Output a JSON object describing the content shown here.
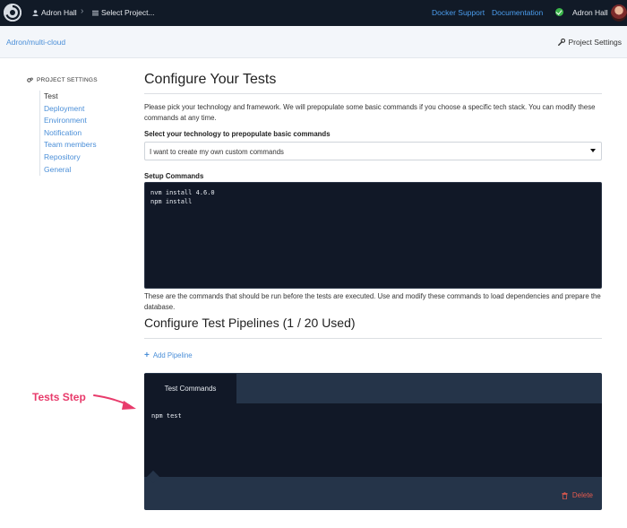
{
  "topnav": {
    "logo": "circleci-logo-icon",
    "user_crumb": "Adron Hall",
    "project_crumb": "Select Project...",
    "docker_support": "Docker Support",
    "documentation": "Documentation",
    "user_name": "Adron Hall",
    "status_color": "#3bb54a"
  },
  "subheader": {
    "project": "Adron/multi-cloud",
    "settings": "Project Settings"
  },
  "sidebar": {
    "heading": "PROJECT SETTINGS",
    "items": [
      {
        "label": "Test",
        "active": true
      },
      {
        "label": "Deployment"
      },
      {
        "label": "Environment"
      },
      {
        "label": "Notification"
      },
      {
        "label": "Team members"
      },
      {
        "label": "Repository"
      },
      {
        "label": "General"
      }
    ]
  },
  "main": {
    "title": "Configure Your Tests",
    "intro": "Please pick your technology and framework. We will prepopulate some basic commands if you choose a specific tech stack. You can modify these commands at any time.",
    "tech_label": "Select your technology to prepopulate basic commands",
    "tech_selected": "I want to create my own custom commands",
    "setup_label": "Setup Commands",
    "setup_commands": [
      "nvm install 4.6.0",
      "npm install"
    ],
    "setup_help": "These are the commands that should be run before the tests are executed. Use and modify these commands to load dependencies and prepare the database.",
    "pipelines_title": "Configure Test Pipelines (1 / 20 Used)",
    "add_pipeline": "Add Pipeline",
    "pipeline": {
      "tab": "Test Commands",
      "commands": [
        "npm test"
      ],
      "delete": "Delete"
    }
  },
  "annotation": {
    "text": "Tests Step",
    "color": "#e83b6b"
  },
  "colors": {
    "topbar": "#111a27",
    "link": "#4b8fd8",
    "editor": "#111827",
    "pipeline_frame": "#253449",
    "danger": "#e55a4e"
  }
}
